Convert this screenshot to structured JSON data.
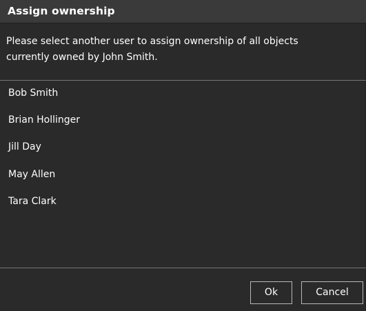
{
  "dialog": {
    "title": "Assign ownership",
    "message_line1": "Please select another user to assign ownership of all objects",
    "message_line2": "currently owned by John Smith."
  },
  "users": [
    {
      "label": "Bob Smith"
    },
    {
      "label": "Brian Hollinger"
    },
    {
      "label": "Jill Day"
    },
    {
      "label": "May Allen"
    },
    {
      "label": "Tara Clark"
    }
  ],
  "buttons": {
    "ok_label": "Ok",
    "cancel_label": "Cancel"
  },
  "colors": {
    "background": "#2a2a2a",
    "titlebar": "#3a3a3a",
    "text": "#ffffff",
    "divider": "#757575",
    "button_border": "#b9b9b9"
  }
}
